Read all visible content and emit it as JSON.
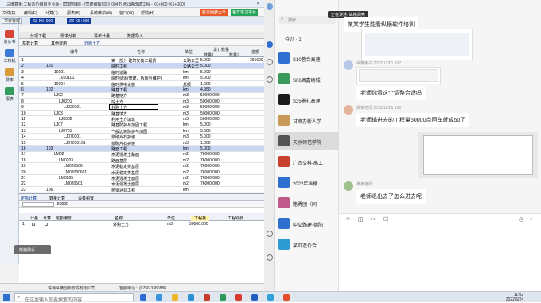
{
  "app": {
    "title": "三维算量:工程造价编审专业版 - [营建项目] - [营建编辑] 四川004五通公路改建工程 - K0+000~K5+000]",
    "menus": [
      "文件(F)",
      "编辑(E)",
      "计算(J)",
      "报表(B)",
      "系统维护(W)",
      "窗口(W)",
      "帮助(H)"
    ],
    "ad1": "好光网路大全",
    "ad2": "第五学习平台",
    "toolbar_items": [
      "项目管理",
      "ZZ-K0+000",
      "ZZ-K5+000"
    ],
    "sidebar": [
      {
        "label": "造价书",
        "color": "#d8463a"
      },
      {
        "label": "工料机",
        "color": "#3a7ad8"
      },
      {
        "label": "费率",
        "color": "#d89a3a"
      },
      {
        "label": "报表",
        "color": "#2f9c5a"
      }
    ],
    "tabs": [
      "分项工程",
      "需求分析",
      "清单计量",
      "数据导入"
    ],
    "section_tabs": [
      "基数计算",
      "其他费用"
    ],
    "crumb_item": "外购土方",
    "grid_header": {
      "col_code": "编号",
      "col_name": "名称",
      "col_unit": "单位",
      "design_qty": "设计数量",
      "qty1": "数量1",
      "qty2": "数量2",
      "amount": "金额"
    },
    "rows": [
      {
        "n": "1",
        "code": "",
        "name": "第一部分 建筑安装工程费",
        "unit": "公路公里",
        "q1": "5.000",
        "q2": "",
        "amt": "365600",
        "blue": false
      },
      {
        "n": "2",
        "code": "101",
        "name": "临时工程",
        "unit": "公路公里",
        "q1": "5.000",
        "q2": "",
        "amt": "",
        "blue": true
      },
      {
        "n": "3",
        "code": "10101",
        "name": "临时道路",
        "unit": "km",
        "q1": "5.000",
        "q2": "",
        "amt": "",
        "blue": false
      },
      {
        "n": "4",
        "code": "1010101",
        "name": "临时便道(修建、拆除与维护)",
        "unit": "km",
        "q1": "5.000",
        "q2": "",
        "amt": "",
        "blue": false
      },
      {
        "n": "5",
        "code": "10104",
        "name": "临时供电设施",
        "unit": "总额",
        "q1": "1.000",
        "q2": "",
        "amt": "",
        "blue": false
      },
      {
        "n": "6",
        "code": "102",
        "name": "路基工程",
        "unit": "km",
        "q1": "4.950",
        "q2": "",
        "amt": "",
        "blue": true
      },
      {
        "n": "7",
        "code": "LJ02",
        "name": "路基挖方",
        "unit": "m3",
        "q1": "50000.000",
        "q2": "",
        "amt": "",
        "blue": false
      },
      {
        "n": "8",
        "code": "LJ0201",
        "name": "挖土方",
        "unit": "m3",
        "q1": "50000.000",
        "q2": "",
        "amt": "",
        "blue": false
      },
      {
        "n": "9",
        "code": "LJ020101",
        "name": "外购土方",
        "unit": "m3",
        "q1": "50000.000",
        "q2": "",
        "amt": "",
        "blue": false,
        "selected": true
      },
      {
        "n": "10",
        "code": "LJ03",
        "name": "路基填方",
        "unit": "m3",
        "q1": "50000.000",
        "q2": "",
        "amt": "",
        "blue": false
      },
      {
        "n": "11",
        "code": "LJ0302",
        "name": "利用土方填筑",
        "unit": "m3",
        "q1": "50000.000",
        "q2": "",
        "amt": "",
        "blue": false
      },
      {
        "n": "12",
        "code": "LJ07",
        "name": "路基防护与加固工程",
        "unit": "km",
        "q1": "5.000",
        "q2": "",
        "amt": "",
        "blue": false
      },
      {
        "n": "13",
        "code": "LJ0701",
        "name": "一般边坡防护与加固",
        "unit": "km",
        "q1": "5.000",
        "q2": "",
        "amt": "",
        "blue": false
      },
      {
        "n": "14",
        "code": "LJ070101",
        "name": "浆砌片石护坡",
        "unit": "m3",
        "q1": "5.000",
        "q2": "",
        "amt": "",
        "blue": false
      },
      {
        "n": "15",
        "code": "LJ07010101",
        "name": "浆砌片石护坡",
        "unit": "m3",
        "q1": "1.000",
        "q2": "",
        "amt": "",
        "blue": false
      },
      {
        "n": "16",
        "code": "103",
        "name": "路面工程",
        "unit": "km",
        "q1": "5.000",
        "q2": "",
        "amt": "",
        "blue": true
      },
      {
        "n": "17",
        "code": "LM02",
        "name": "水泥混凝土路面",
        "unit": "m2",
        "q1": "76000.000",
        "q2": "",
        "amt": "",
        "blue": false
      },
      {
        "n": "18",
        "code": "LM0203",
        "name": "路面基层",
        "unit": "m2",
        "q1": "76000.000",
        "q2": "",
        "amt": "",
        "blue": false
      },
      {
        "n": "19",
        "code": "LM020306",
        "name": "水泥稳定类基层",
        "unit": "m2",
        "q1": "76000.000",
        "q2": "",
        "amt": "",
        "blue": false
      },
      {
        "n": "20",
        "code": "LM02030601",
        "name": "水泥稳定类基层",
        "unit": "m2",
        "q1": "76000.000",
        "q2": "",
        "amt": "",
        "blue": false
      },
      {
        "n": "21",
        "code": "LM0205",
        "name": "水泥混凝土面层",
        "unit": "m2",
        "q1": "76000.000",
        "q2": "",
        "amt": "",
        "blue": false
      },
      {
        "n": "22",
        "code": "LM020501",
        "name": "水泥混凝土面层",
        "unit": "m2",
        "q1": "76000.000",
        "q2": "",
        "amt": "",
        "blue": false
      },
      {
        "n": "23",
        "code": "106",
        "name": "桥梁涵洞工程",
        "unit": "km",
        "q1": "",
        "q2": "",
        "amt": "",
        "blue": false
      }
    ],
    "bottom": {
      "tabs": [
        "定额计算",
        "数量计算",
        "设备购置"
      ],
      "filter": "50000",
      "head": [
        "计量",
        "计算",
        "定额编号",
        "名称",
        "单位",
        "工程量",
        "工程取费"
      ],
      "row": {
        "n": "1",
        "name": "外购土方",
        "unit": "m3",
        "qty": "50000.000"
      }
    },
    "overlay_text": "熊猫助手...",
    "statusbar": [
      "珠海纵横创新软件有限公司",
      "客服电话：(0756)3380888"
    ]
  },
  "chat": {
    "search_placeholder": "搜索",
    "pending": "待办 · 1",
    "conversations": [
      {
        "name": "S10蓉合高速",
        "color": "#2e6fd0"
      },
      {
        "name": "S06酒嘉绕城",
        "color": "#3a9a5a"
      },
      {
        "name": "S35景礼高速",
        "color": "#1b1b1b"
      },
      {
        "name": "甘肃办新人学",
        "color": "#c79a5a"
      },
      {
        "name": "天水师范学院",
        "color": "#555555"
      },
      {
        "name": "广西交科-高工",
        "color": "#c8412f"
      },
      {
        "name": "2022年纵横",
        "color": "#2e6fd0"
      },
      {
        "name": "路勇团（同",
        "color": "#c05a8a"
      },
      {
        "name": "中交路建-德阳",
        "color": "#2e6fd0"
      },
      {
        "name": "某瓜造价合",
        "color": "#2e9bd0"
      }
    ],
    "live_banner": "正在讲述: 纵横阅亮",
    "msg_top": "某某学生能看纵横软件培训",
    "meta1": "纵横用户 2022/12/01 107",
    "msg1": "老师你看这个调整合适吗",
    "meta2": "某某老师 2022/12/01 109",
    "msg2": "老师输进去的工程量50000点回车就成50了",
    "meta3": "某某老师",
    "msg3": "老师退出去了怎么进去呢",
    "tools": [
      "☺",
      "◫",
      "✂",
      "☐",
      "◷",
      "♪"
    ]
  },
  "taskbar": {
    "search_placeholder": "在这里输入你要搜索的内容",
    "time": "11:02",
    "date": "2022/6/24"
  }
}
